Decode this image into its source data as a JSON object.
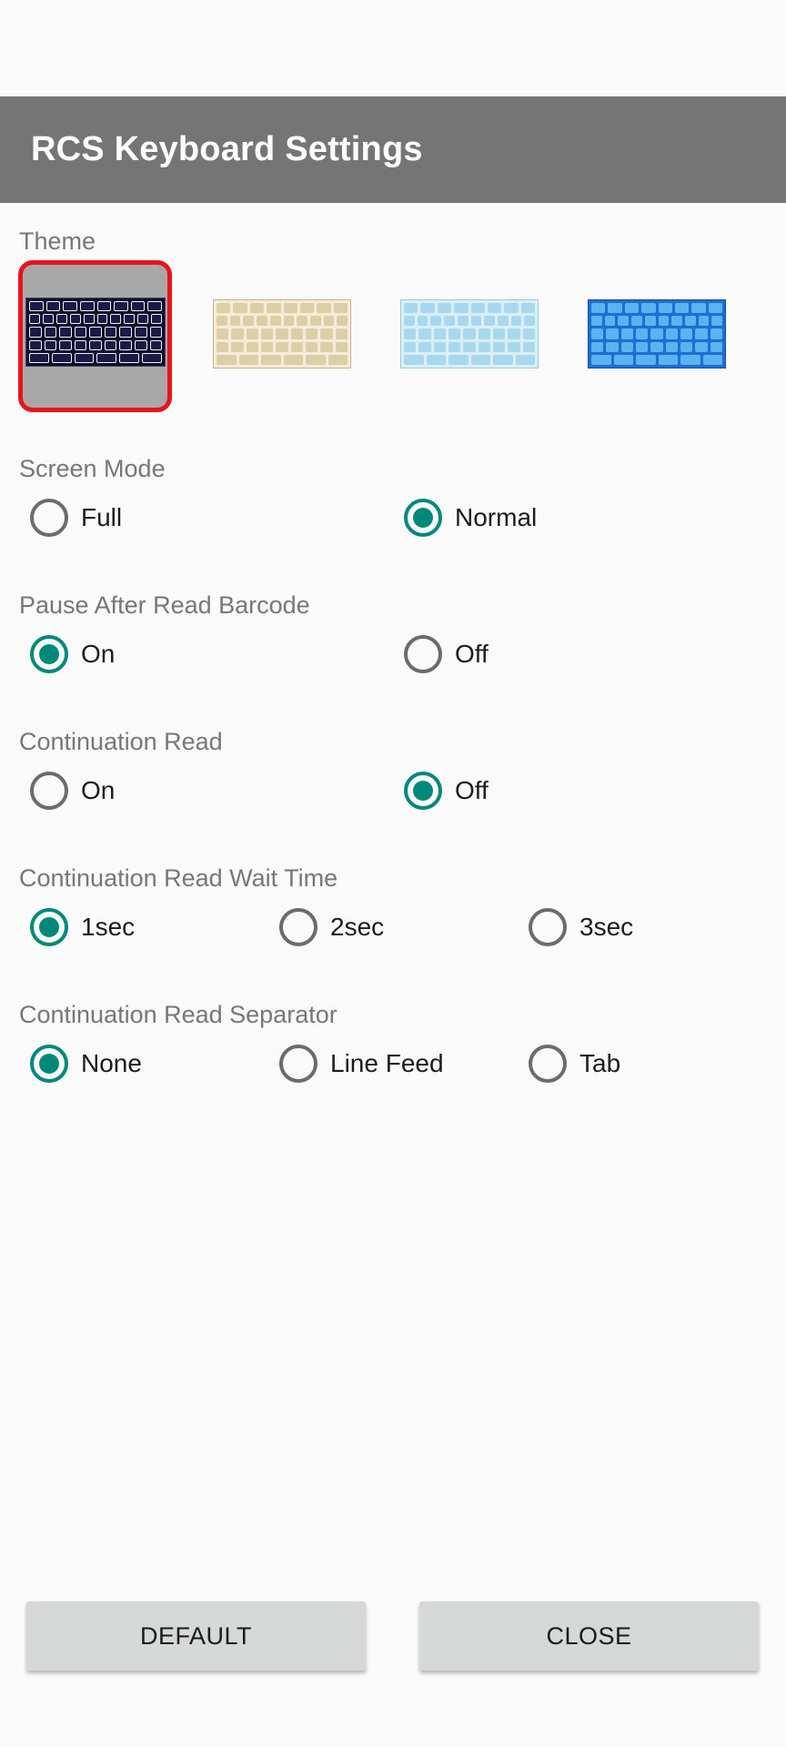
{
  "title": "RCS Keyboard Settings",
  "theme": {
    "label": "Theme",
    "options": [
      {
        "name": "dark-keyboard-theme",
        "selected": true,
        "bg": "#0d0d2e",
        "key": "#f2f2f2",
        "border": "#444466"
      },
      {
        "name": "beige-keyboard-theme",
        "selected": false,
        "bg": "#f4ecd8",
        "key": "#dccfa8",
        "border": "#c7b48a"
      },
      {
        "name": "light-blue-keyboard-theme",
        "selected": false,
        "bg": "#d8f0f4",
        "key": "#a8d8ee",
        "border": "#9cc7df"
      },
      {
        "name": "blue-keyboard-theme",
        "selected": false,
        "bg": "#1e6fd0",
        "key": "#5ab4f2",
        "border": "#0c4fa6"
      }
    ]
  },
  "screen_mode": {
    "label": "Screen Mode",
    "options": [
      "Full",
      "Normal"
    ],
    "selected": "Normal"
  },
  "pause_after_read_barcode": {
    "label": "Pause After Read Barcode",
    "options": [
      "On",
      "Off"
    ],
    "selected": "On"
  },
  "continuation_read": {
    "label": "Continuation Read",
    "options": [
      "On",
      "Off"
    ],
    "selected": "Off"
  },
  "continuation_read_wait_time": {
    "label": "Continuation Read Wait Time",
    "options": [
      "1sec",
      "2sec",
      "3sec"
    ],
    "selected": "1sec"
  },
  "continuation_read_separator": {
    "label": "Continuation Read Separator",
    "options": [
      "None",
      "Line Feed",
      "Tab"
    ],
    "selected": "None"
  },
  "buttons": {
    "default_label": "DEFAULT",
    "close_label": "CLOSE"
  },
  "colors": {
    "titlebar": "#757575",
    "accent": "#00897b",
    "selection_border": "#e8141c"
  }
}
